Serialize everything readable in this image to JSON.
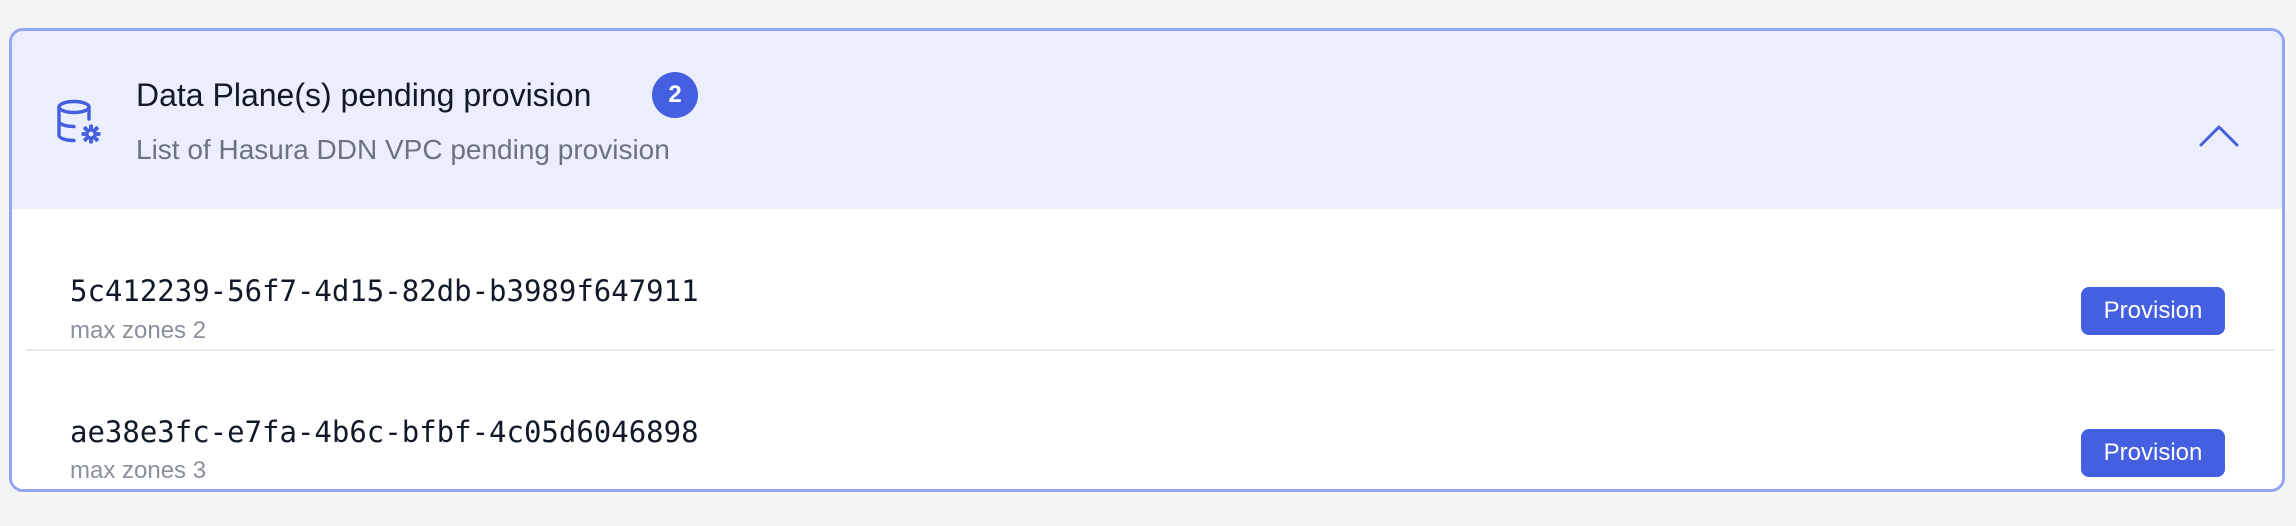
{
  "panel": {
    "icon": "database-gear-icon",
    "title": "Data Plane(s) pending provision",
    "count": "2",
    "subtitle": "List of Hasura DDN VPC pending provision",
    "toggle_icon": "chevron-up-icon",
    "expanded": true
  },
  "rows": [
    {
      "id": "5c412239-56f7-4d15-82db-b3989f647911",
      "meta": "max zones 2",
      "action_label": "Provision"
    },
    {
      "id": "ae38e3fc-e7fa-4b6c-bfbf-4c05d6046898",
      "meta": "max zones 3",
      "action_label": "Provision"
    }
  ],
  "colors": {
    "accent": "#4460e0",
    "border": "#94a6f2",
    "header_bg": "#ebeffb",
    "page_bg": "#f3f4f6"
  }
}
